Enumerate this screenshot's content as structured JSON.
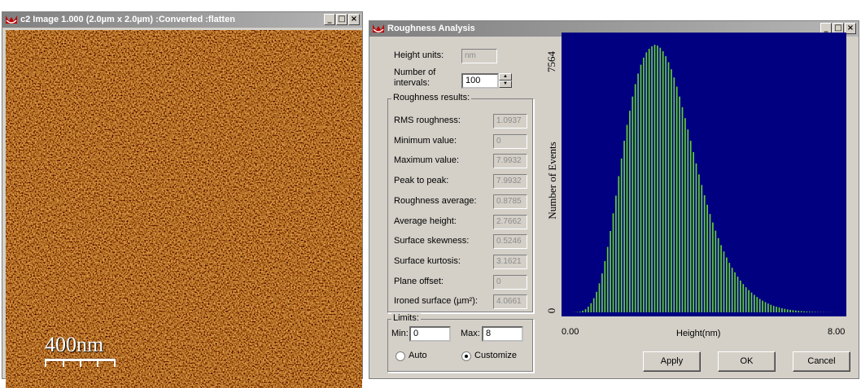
{
  "image_window": {
    "title": "c2 Image 1.000 (2.0µm x 2.0µm) :Converted :flatten",
    "scale_label": "400nm"
  },
  "roughness_window": {
    "title": "Roughness Analysis",
    "height_units_label": "Height units:",
    "height_units_value": "nm",
    "intervals_label_1": "Number of",
    "intervals_label_2": "intervals:",
    "intervals_value": "100",
    "results_group": "Roughness results:",
    "results": [
      {
        "label": "RMS roughness:",
        "value": "1.0937"
      },
      {
        "label": "Minimum value:",
        "value": "0"
      },
      {
        "label": "Maximum value:",
        "value": "7.9932"
      },
      {
        "label": "Peak  to peak:",
        "value": "7.9932"
      },
      {
        "label": "Roughness average:",
        "value": "0.8785"
      },
      {
        "label": "Average height:",
        "value": "2.7662"
      },
      {
        "label": "Surface skewness:",
        "value": "0.5246"
      },
      {
        "label": "Surface kurtosis:",
        "value": "3.1621"
      },
      {
        "label": "Plane offset:",
        "value": "0"
      },
      {
        "label": "Ironed surface (µm²):",
        "value": "4.0661"
      }
    ],
    "limits": {
      "group": "Limits:",
      "min_label": "Min:",
      "min_value": "0",
      "max_label": "Max:",
      "max_value": "8",
      "auto_label": "Auto",
      "customize_label": "Customize",
      "selected": "Customize"
    },
    "buttons": {
      "apply": "Apply",
      "ok": "OK",
      "cancel": "Cancel"
    }
  },
  "colors": {
    "plot_background": "#000080",
    "bars": "#66cc33",
    "afm_base": "#b0520f"
  },
  "chart_data": {
    "type": "bar",
    "xlabel": "Height(nm)",
    "ylabel": "Number of Events",
    "xlim": [
      0.0,
      8.0
    ],
    "ylim": [
      0,
      7564
    ],
    "x_tick_labels": [
      "0.00",
      "8.00"
    ],
    "y_tick_labels": [
      "0",
      "7564"
    ],
    "bins": 100,
    "values": [
      0,
      0,
      2,
      5,
      10,
      20,
      45,
      90,
      160,
      260,
      400,
      580,
      820,
      1100,
      1450,
      1850,
      2300,
      2800,
      3300,
      3850,
      4350,
      4850,
      5300,
      5700,
      6100,
      6450,
      6750,
      7000,
      7200,
      7350,
      7450,
      7520,
      7564,
      7540,
      7480,
      7380,
      7240,
      7070,
      6870,
      6640,
      6380,
      6100,
      5800,
      5490,
      5170,
      4850,
      4530,
      4210,
      3900,
      3600,
      3310,
      3040,
      2780,
      2540,
      2310,
      2100,
      1900,
      1720,
      1550,
      1400,
      1260,
      1130,
      1010,
      900,
      800,
      710,
      630,
      560,
      495,
      435,
      380,
      330,
      290,
      250,
      215,
      185,
      160,
      138,
      118,
      100,
      85,
      72,
      61,
      51,
      43,
      36,
      30,
      25,
      20,
      16,
      13,
      10,
      8,
      6,
      5,
      4,
      3,
      2,
      1,
      0
    ]
  }
}
